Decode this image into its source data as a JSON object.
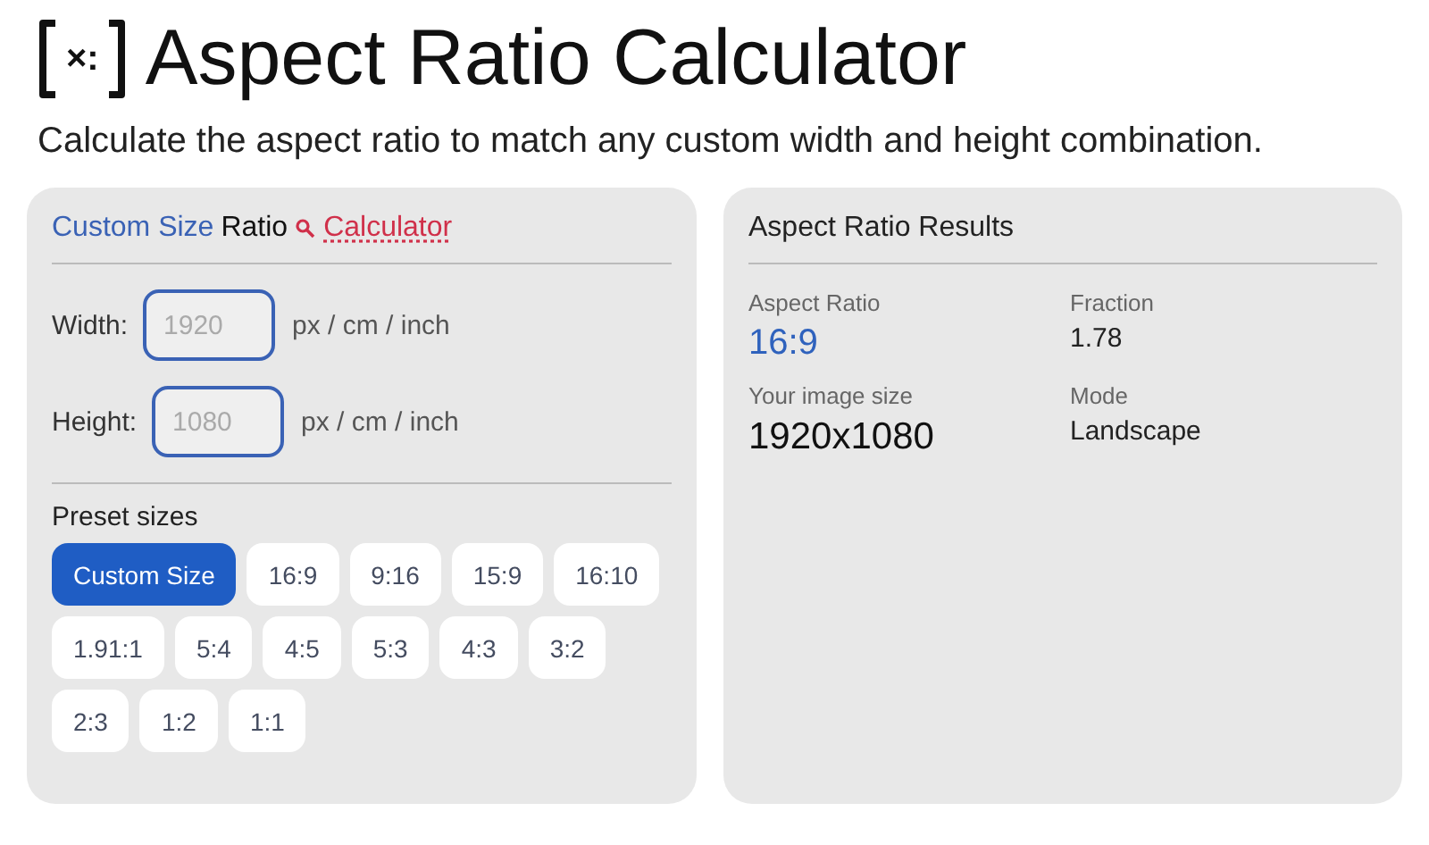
{
  "header": {
    "logo_mark": "×:",
    "title": "Aspect Ratio Calculator",
    "subtitle": "Calculate the aspect ratio to match any custom width and height combination."
  },
  "calculator": {
    "title_prefix": "Custom Size",
    "title_main": "Ratio",
    "title_link": "Calculator",
    "fields": [
      {
        "label": "Width:",
        "placeholder": "1920",
        "unit": "px / cm / inch"
      },
      {
        "label": "Height:",
        "placeholder": "1080",
        "unit": "px / cm / inch"
      }
    ],
    "presets_label": "Preset sizes",
    "presets": [
      {
        "label": "Custom Size",
        "selected": true
      },
      {
        "label": "16:9",
        "selected": false
      },
      {
        "label": "9:16",
        "selected": false
      },
      {
        "label": "15:9",
        "selected": false
      },
      {
        "label": "16:10",
        "selected": false
      },
      {
        "label": "1.91:1",
        "selected": false
      },
      {
        "label": "5:4",
        "selected": false
      },
      {
        "label": "4:5",
        "selected": false
      },
      {
        "label": "5:3",
        "selected": false
      },
      {
        "label": "4:3",
        "selected": false
      },
      {
        "label": "3:2",
        "selected": false
      },
      {
        "label": "2:3",
        "selected": false
      },
      {
        "label": "1:2",
        "selected": false
      },
      {
        "label": "1:1",
        "selected": false
      }
    ]
  },
  "results": {
    "title": "Aspect Ratio Results",
    "items": [
      {
        "label": "Aspect Ratio",
        "value": "16:9",
        "kind": "highlight"
      },
      {
        "label": "Fraction",
        "value": "1.78",
        "kind": "plain"
      },
      {
        "label": "Your image size",
        "value": "1920x1080",
        "kind": "large"
      },
      {
        "label": "Mode",
        "value": "Landscape",
        "kind": "plain"
      }
    ]
  }
}
